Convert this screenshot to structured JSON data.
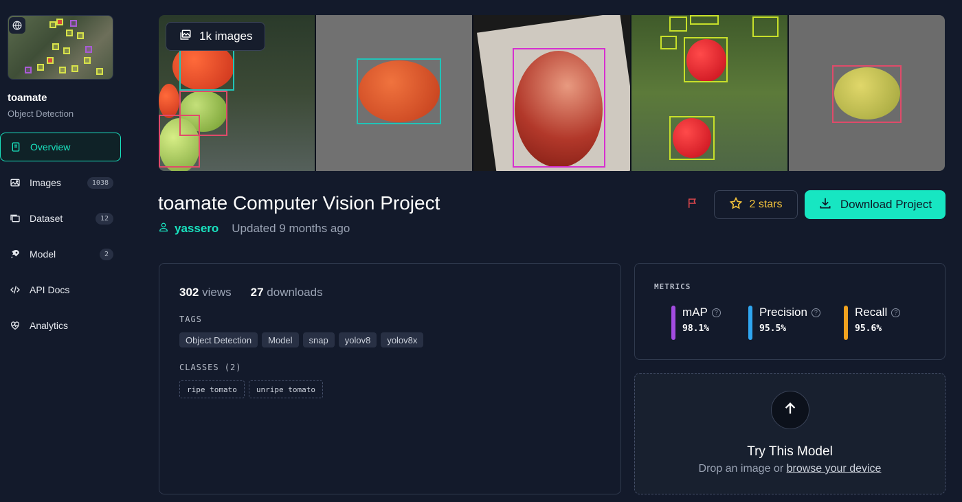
{
  "sidebar": {
    "project_name": "toamate",
    "project_type": "Object Detection",
    "items": [
      {
        "label": "Overview",
        "count": null,
        "icon": "book-icon"
      },
      {
        "label": "Images",
        "count": "1038",
        "icon": "image-icon"
      },
      {
        "label": "Dataset",
        "count": "12",
        "icon": "folders-icon"
      },
      {
        "label": "Model",
        "count": "2",
        "icon": "rocket-icon"
      },
      {
        "label": "API Docs",
        "count": null,
        "icon": "code-icon"
      },
      {
        "label": "Analytics",
        "count": null,
        "icon": "heart-pulse-icon"
      }
    ]
  },
  "gallery": {
    "images_badge": "1k images"
  },
  "header": {
    "title": "toamate Computer Vision Project",
    "author": "yassero",
    "updated": "Updated 9 months ago",
    "stars_label": "2 stars",
    "download_label": "Download Project"
  },
  "info": {
    "views_count": "302",
    "views_label": "views",
    "downloads_count": "27",
    "downloads_label": "downloads",
    "tags_heading": "TAGS",
    "tags": [
      "Object Detection",
      "Model",
      "snap",
      "yolov8",
      "yolov8x"
    ],
    "classes_heading": "CLASSES (2)",
    "classes": [
      "ripe tomato",
      "unripe tomato"
    ]
  },
  "metrics": {
    "heading": "METRICS",
    "items": [
      {
        "name": "mAP",
        "value": "98.1%",
        "color": "#a24ce0"
      },
      {
        "name": "Precision",
        "value": "95.5%",
        "color": "#2fa6f0"
      },
      {
        "name": "Recall",
        "value": "95.6%",
        "color": "#f0a21f"
      }
    ]
  },
  "try_model": {
    "title": "Try This Model",
    "sub_prefix": "Drop an image or",
    "sub_link": "browse your device"
  },
  "colors": {
    "accent": "#19e4c0",
    "background": "#131a2b",
    "star": "#f2c23b",
    "flag": "#e5484d"
  }
}
